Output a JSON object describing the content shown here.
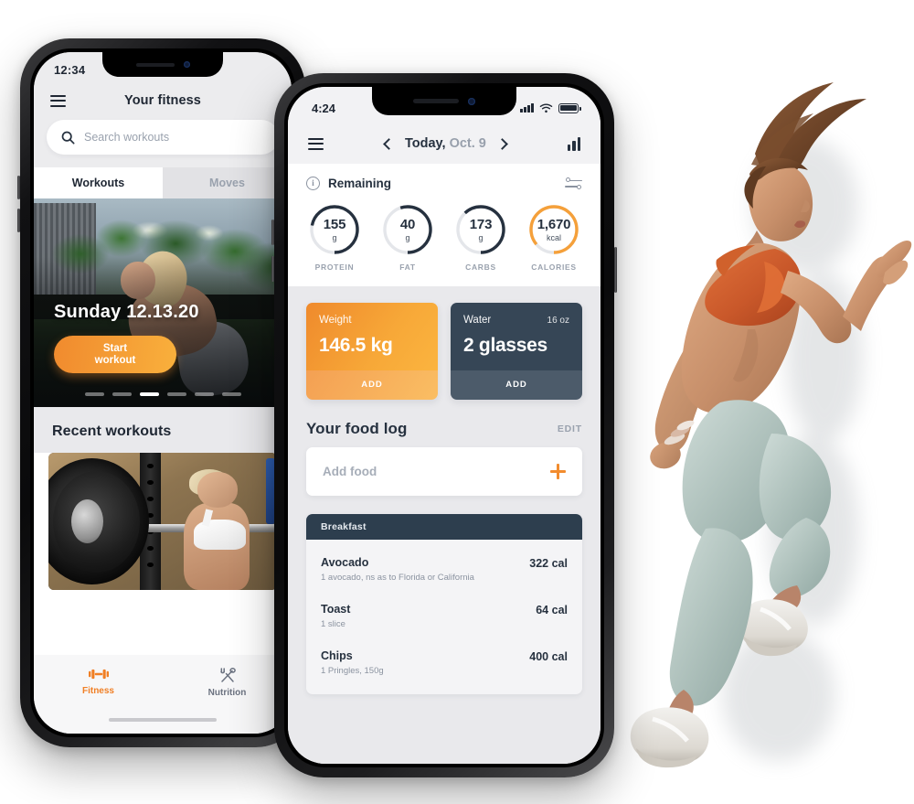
{
  "left_phone": {
    "status": {
      "time": "12:34"
    },
    "header": {
      "title": "Your fitness",
      "menu_icon": "hamburger-icon"
    },
    "search": {
      "placeholder": "Search workouts",
      "icon": "search-icon"
    },
    "tabs": [
      {
        "label": "Workouts",
        "active": true
      },
      {
        "label": "Moves",
        "active": false
      }
    ],
    "hero": {
      "date": "Sunday 12.13.20",
      "cta_line1": "Start",
      "cta_line2": "workout",
      "dots_total": 6,
      "dot_active_index": 3
    },
    "recent": {
      "title": "Recent workouts"
    },
    "tabbar": [
      {
        "label": "Fitness",
        "icon": "dumbbell-icon",
        "active": true
      },
      {
        "label": "Nutrition",
        "icon": "fork-spoon-icon",
        "active": false
      }
    ]
  },
  "right_phone": {
    "status": {
      "time": "4:24",
      "signal_icon": "signal-bars-icon",
      "wifi_icon": "wifi-icon",
      "battery_icon": "battery-icon"
    },
    "header": {
      "menu_icon": "hamburger-icon",
      "prev_icon": "chevron-left-icon",
      "next_icon": "chevron-right-icon",
      "date_prefix": "Today,",
      "date_value": "Oct. 9",
      "chart_icon": "bar-chart-icon"
    },
    "remaining": {
      "title": "Remaining",
      "info_icon": "info-circle-icon",
      "settings_icon": "sliders-icon"
    },
    "cards": {
      "weight": {
        "title": "Weight",
        "value": "146.5 kg",
        "action": "ADD"
      },
      "water": {
        "title": "Water",
        "sub": "16 oz",
        "value": "2 glasses",
        "action": "ADD"
      }
    },
    "food_log": {
      "title": "Your food log",
      "edit": "EDIT",
      "add_food": {
        "label": "Add food",
        "icon": "plus-icon"
      },
      "meal": {
        "name": "Breakfast",
        "items": [
          {
            "name": "Avocado",
            "desc": "1 avocado, ns as to Florida or California",
            "calories": "322 cal"
          },
          {
            "name": "Toast",
            "desc": "1 slice",
            "calories": "64 cal"
          },
          {
            "name": "Chips",
            "desc": "1 Pringles, 150g",
            "calories": "400 cal"
          }
        ]
      }
    },
    "chart_data": {
      "type": "bar",
      "title": "Remaining macros",
      "categories": [
        "PROTEIN",
        "FAT",
        "CARBS",
        "CALORIES"
      ],
      "values": [
        155,
        40,
        173,
        1670
      ],
      "units": [
        "g",
        "g",
        "g",
        "kcal"
      ],
      "display_values": [
        "155",
        "40",
        "173",
        "1,670"
      ],
      "arc_fraction": [
        0.72,
        0.55,
        0.62,
        0.86
      ],
      "track_color": "#e4e6ea",
      "series_colors": [
        "#26313f",
        "#26313f",
        "#26313f",
        "#F5A03A"
      ],
      "xlabel": "",
      "ylabel": "",
      "legend": "none"
    }
  },
  "colors": {
    "accent_orange": "#F08A2E",
    "accent_orange_light": "#FBB43F",
    "dark_navy": "#26313f",
    "slate": "#364656",
    "muted_gray": "#9aa2ae",
    "screen_bg": "#e9e9ec"
  }
}
